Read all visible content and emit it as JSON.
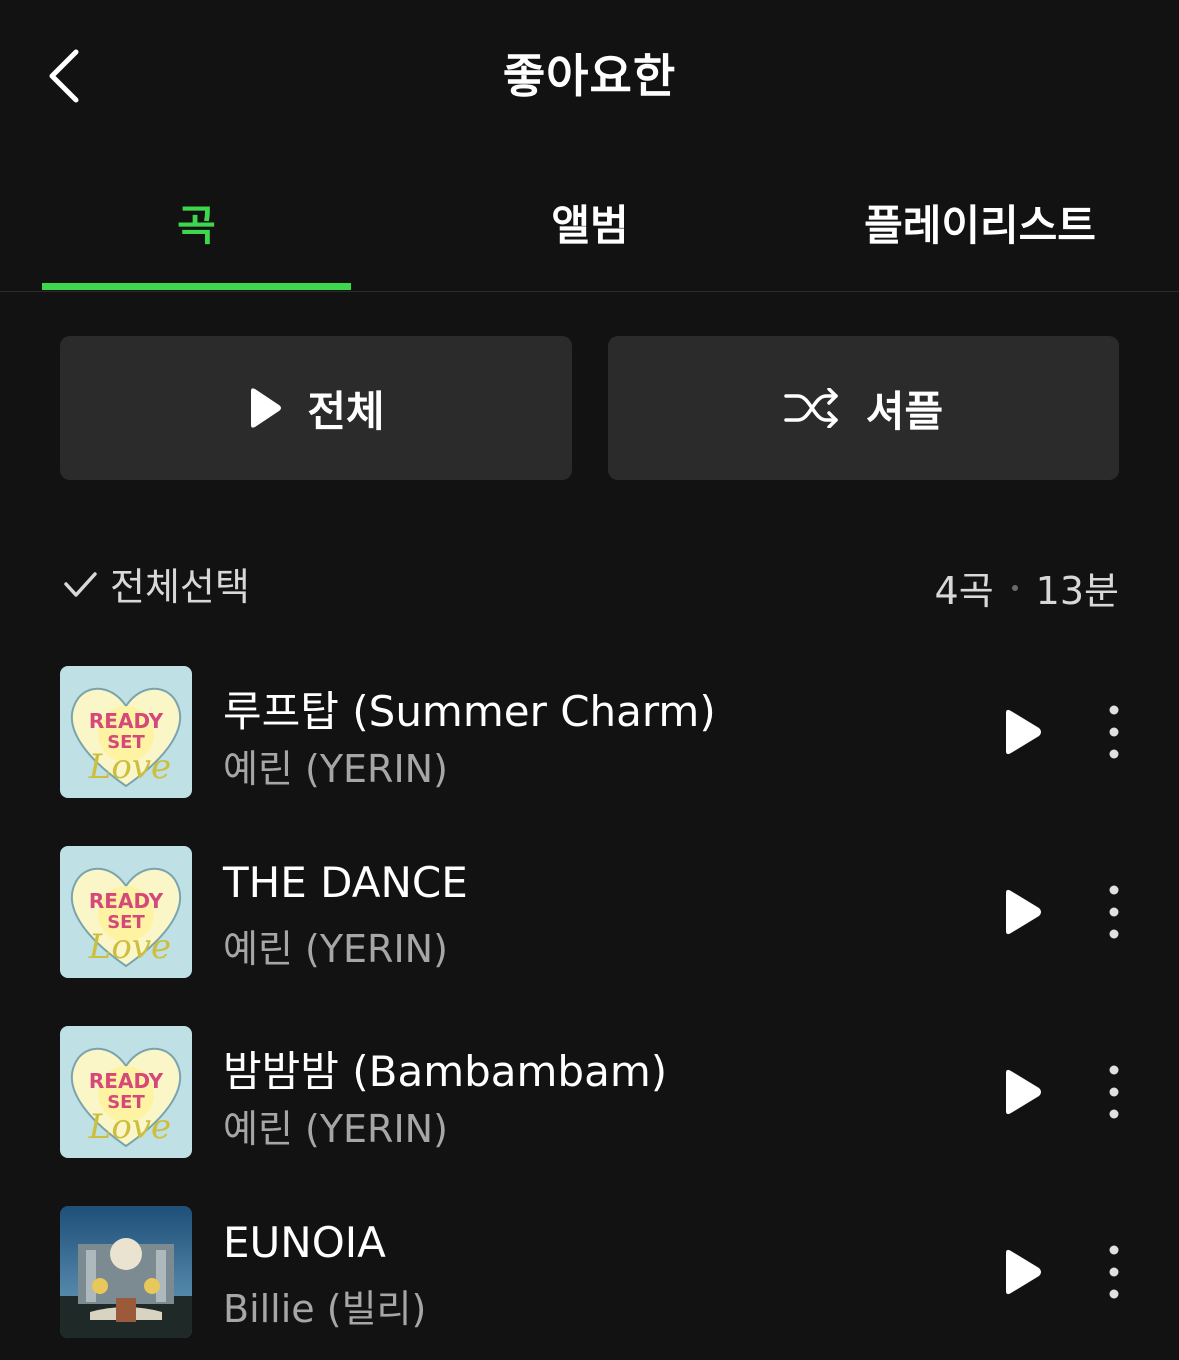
{
  "header": {
    "title": "좋아요한",
    "back_icon": "chevron-left-icon"
  },
  "tabs": [
    {
      "label": "곡",
      "active": true
    },
    {
      "label": "앨범",
      "active": false
    },
    {
      "label": "플레이리스트",
      "active": false
    }
  ],
  "actions": {
    "play_all_label": "전체",
    "play_all_icon": "play-icon",
    "shuffle_label": "셔플",
    "shuffle_icon": "shuffle-icon"
  },
  "selection": {
    "select_all_label": "전체선택",
    "check_icon": "check-icon",
    "song_count": "4곡",
    "duration": "13분"
  },
  "tracks": [
    {
      "title": "루프탑 (Summer Charm)",
      "artist": "예린 (YERIN)",
      "cover": "ready-set-love-cover"
    },
    {
      "title": "THE DANCE",
      "artist": "예린 (YERIN)",
      "cover": "ready-set-love-cover"
    },
    {
      "title": "밤밤밤 (Bambambam)",
      "artist": "예린 (YERIN)",
      "cover": "ready-set-love-cover"
    },
    {
      "title": "EUNOIA",
      "artist": "Billie (빌리)",
      "cover": "eunoia-cover"
    }
  ],
  "colors": {
    "accent": "#3ed64c",
    "background": "#121212",
    "button_bg": "#2b2b2b",
    "secondary_text": "#a6a6a6"
  }
}
